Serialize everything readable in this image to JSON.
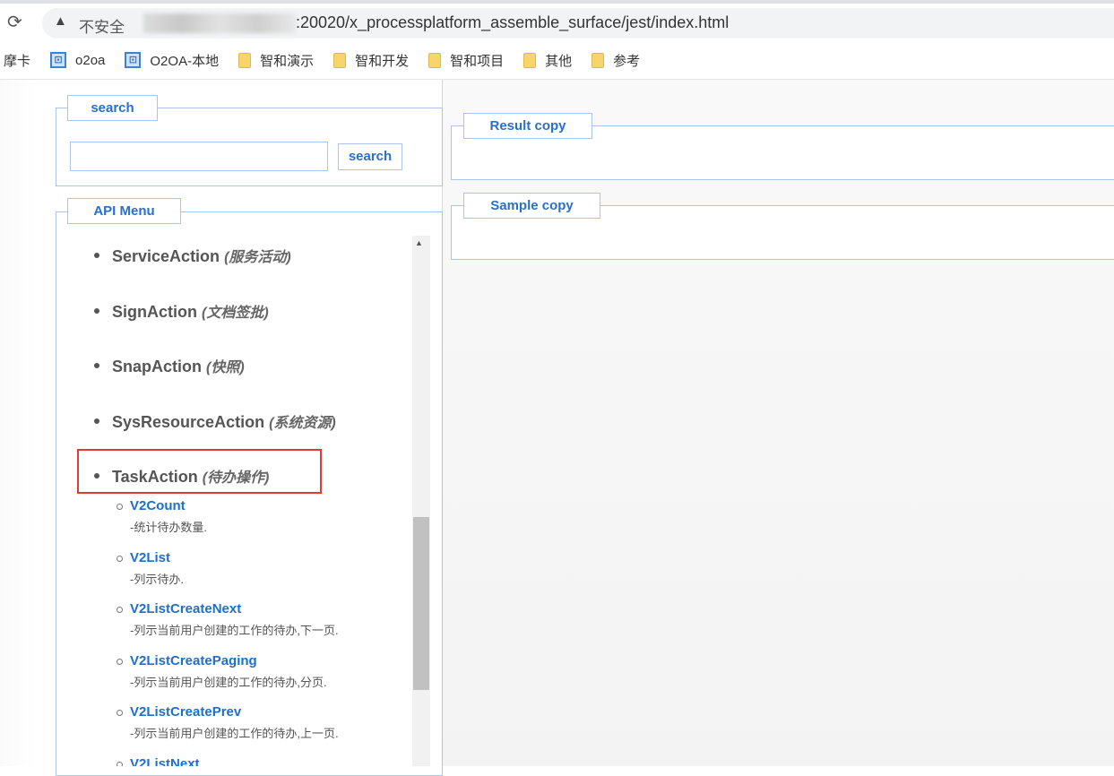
{
  "browser": {
    "insecure_label": "不安全",
    "url_visible": ":20020/x_processplatform_assemble_surface/jest/index.html"
  },
  "bookmarks": [
    {
      "label": "摩卡",
      "icon": "none"
    },
    {
      "label": "o2oa",
      "icon": "page-icon"
    },
    {
      "label": "O2OA-本地",
      "icon": "page-icon"
    },
    {
      "label": "智和演示",
      "icon": "folder-icon"
    },
    {
      "label": "智和开发",
      "icon": "folder-icon"
    },
    {
      "label": "智和项目",
      "icon": "folder-icon"
    },
    {
      "label": "其他",
      "icon": "folder-icon"
    },
    {
      "label": "参考",
      "icon": "folder-icon"
    }
  ],
  "search": {
    "legend": "search",
    "value": "",
    "button": "search"
  },
  "menu": {
    "legend": "API Menu",
    "items": [
      {
        "name": "ServiceAction",
        "cn": "(服务活动)"
      },
      {
        "name": "SignAction",
        "cn": "(文档签批)"
      },
      {
        "name": "SnapAction",
        "cn": "(快照)"
      },
      {
        "name": "SysResourceAction",
        "cn": "(系统资源)"
      },
      {
        "name": "TaskAction",
        "cn": "(待办操作)"
      }
    ],
    "subitems": [
      {
        "name": "V2Count",
        "desc": "-统计待办数量."
      },
      {
        "name": "V2List",
        "desc": "-列示待办."
      },
      {
        "name": "V2ListCreateNext",
        "desc": "-列示当前用户创建的工作的待办,下一页."
      },
      {
        "name": "V2ListCreatePaging",
        "desc": "-列示当前用户创建的工作的待办,分页."
      },
      {
        "name": "V2ListCreatePrev",
        "desc": "-列示当前用户创建的工作的待办,上一页."
      },
      {
        "name": "V2ListNext",
        "desc": ""
      }
    ]
  },
  "result": {
    "legend": "Result copy"
  },
  "sample": {
    "legend": "Sample copy"
  }
}
